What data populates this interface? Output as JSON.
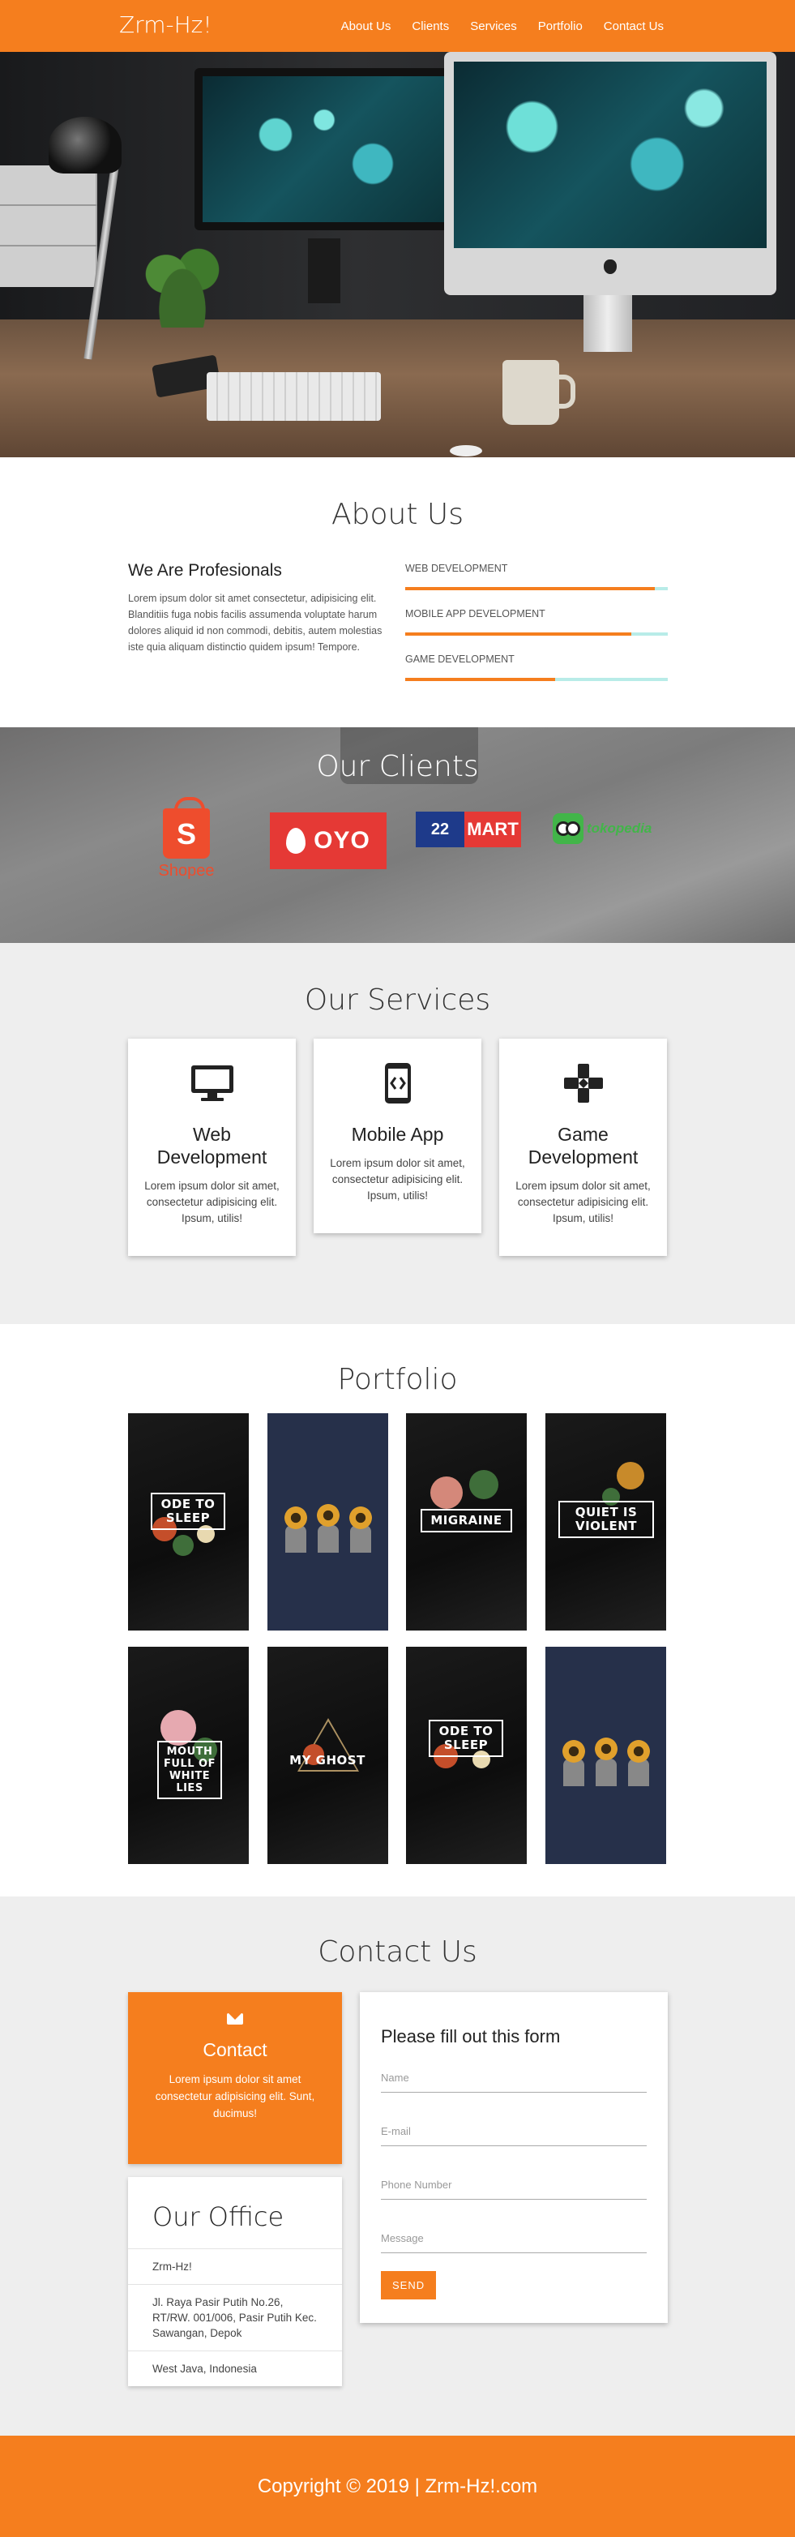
{
  "brand": "Zrm-Hz!",
  "nav": [
    "About Us",
    "Clients",
    "Services",
    "Portfolio",
    "Contact Us"
  ],
  "about": {
    "title": "About Us",
    "heading": "We Are Profesionals",
    "text": "Lorem ipsum dolor sit amet consectetur, adipisicing elit. Blanditiis fuga nobis facilis assumenda voluptate harum dolores aliquid id non commodi, debitis, autem molestias iste quia aliquam distinctio quidem ipsum! Tempore.",
    "skills": [
      {
        "label": "WEB DEVELOPMENT",
        "level": 0.95
      },
      {
        "label": "MOBILE APP DEVELOPMENT",
        "level": 0.86
      },
      {
        "label": "GAME DEVELOPMENT",
        "level": 0.57
      }
    ]
  },
  "clients": {
    "title": "Our Clients",
    "logos": {
      "shopee": {
        "mark": "S",
        "name": "Shopee"
      },
      "oyo": {
        "name": "OYO"
      },
      "mart": {
        "left": "22",
        "right": "MART"
      },
      "toko": {
        "name": "tokopedia"
      }
    }
  },
  "services": {
    "title": "Our Services",
    "items": [
      {
        "icon": "monitor-icon",
        "title": "Web Development",
        "text": "Lorem ipsum dolor sit amet, consectetur adipisicing elit. Ipsum, utilis!"
      },
      {
        "icon": "mobile-code-icon",
        "title": "Mobile App",
        "text": "Lorem ipsum dolor sit amet, consectetur adipisicing elit. Ipsum, utilis!"
      },
      {
        "icon": "gamepad-icon",
        "title": "Game Development",
        "text": "Lorem ipsum dolor sit amet, consectetur adipisicing elit. Ipsum, utilis!"
      }
    ]
  },
  "portfolio": {
    "title": "Portfolio",
    "items": [
      {
        "caption": "ODE TO SLEEP",
        "style": "dark"
      },
      {
        "caption": "",
        "style": "navy"
      },
      {
        "caption": "MIGRAINE",
        "style": "dark"
      },
      {
        "caption": "QUIET IS VIOLENT",
        "style": "dark"
      },
      {
        "caption": "MOUTH FULL OF WHITE LIES",
        "style": "dark"
      },
      {
        "caption": "MY GHOST",
        "style": "dark"
      },
      {
        "caption": "ODE TO SLEEP",
        "style": "dark"
      },
      {
        "caption": "",
        "style": "navy"
      }
    ]
  },
  "contact": {
    "title": "Contact Us",
    "card_title": "Contact",
    "card_text": "Lorem ipsum dolor sit amet consectetur adipisicing elit. Sunt, ducimus!",
    "office_title": "Our Office",
    "office_rows": [
      "Zrm-Hz!",
      "Jl. Raya Pasir Putih No.26, RT/RW. 001/006, Pasir Putih Kec. Sawangan, Depok",
      "West Java, Indonesia"
    ],
    "form_title": "Please fill out this form",
    "placeholders": {
      "name": "Name",
      "email": "E-mail",
      "phone": "Phone Number",
      "message": "Message"
    },
    "send": "SEND"
  },
  "footer": "Copyright © 2019 | Zrm-Hz!.com",
  "colors": {
    "accent": "#f57e1e",
    "bar_track": "#b8ece8"
  }
}
